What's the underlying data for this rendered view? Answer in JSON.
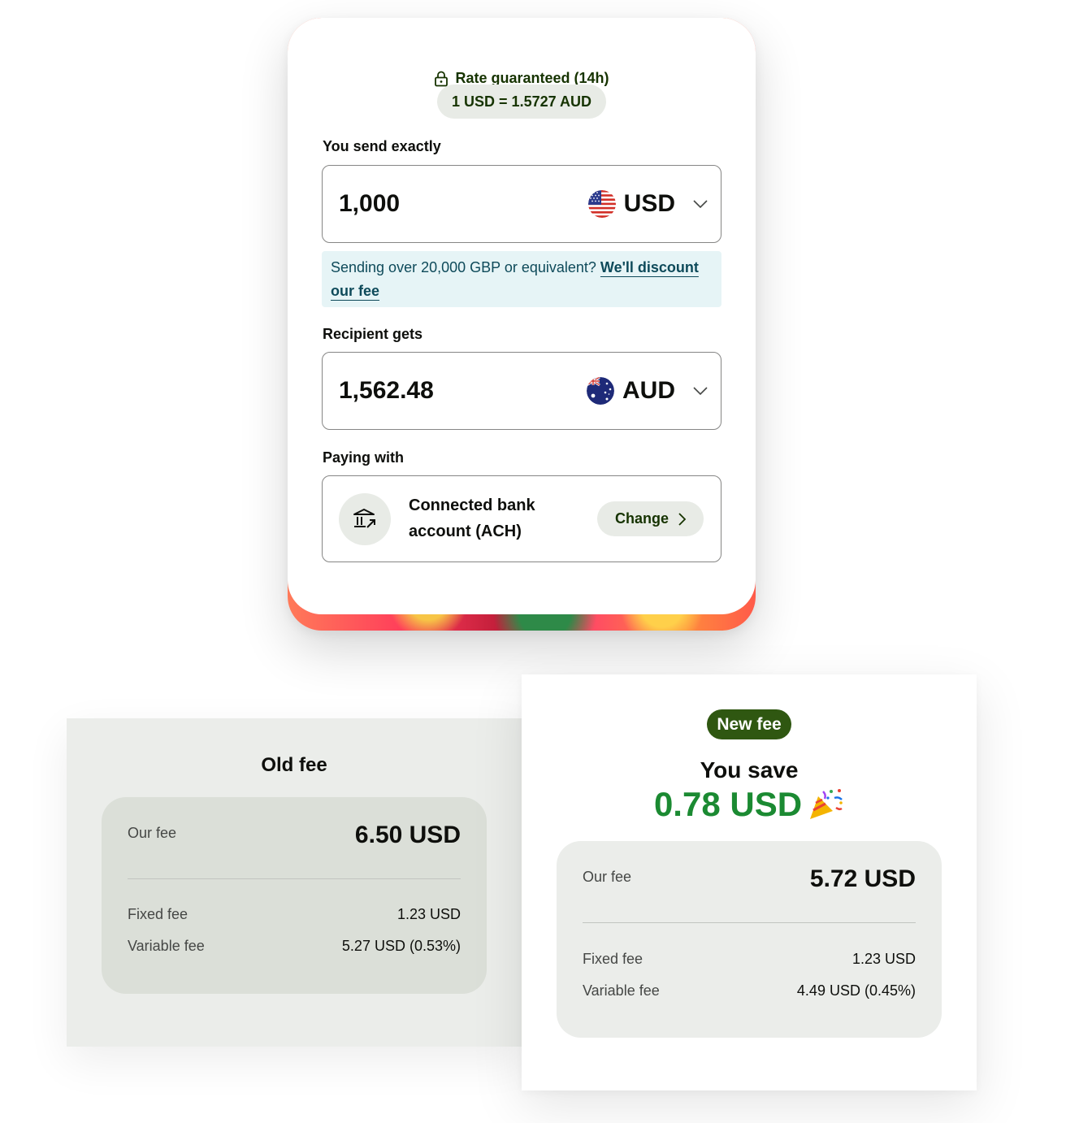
{
  "transfer": {
    "rate_guarantee": "Rate guaranteed (14h)",
    "rate": "1 USD = 1.5727 AUD",
    "send_label": "You send exactly",
    "send_amount": "1,000",
    "send_currency": "USD",
    "discount_text": "Sending over 20,000 GBP or equivalent?",
    "discount_link": "We'll discount our fee",
    "receive_label": "Recipient gets",
    "receive_amount": "1,562.48",
    "receive_currency": "AUD",
    "paying_label": "Paying with",
    "payment_method": "Connected bank account (ACH)",
    "change_label": "Change"
  },
  "old_fee": {
    "title": "Old fee",
    "our_fee_label": "Our fee",
    "our_fee": "6.50 USD",
    "fixed_label": "Fixed fee",
    "fixed": "1.23 USD",
    "variable_label": "Variable fee",
    "variable": "5.27 USD (0.53%)"
  },
  "new_fee": {
    "badge": "New fee",
    "save_label": "You save",
    "save_amount": "0.78 USD",
    "our_fee_label": "Our fee",
    "our_fee": "5.72 USD",
    "fixed_label": "Fixed fee",
    "fixed": "1.23 USD",
    "variable_label": "Variable fee",
    "variable": "4.49 USD (0.45%)"
  },
  "icons": [
    "lock-icon",
    "us-flag-icon",
    "au-flag-icon",
    "chevron-down-icon",
    "bank-icon",
    "chevron-right-icon",
    "party-popper-icon"
  ],
  "colors": {
    "brand_green": "#163300",
    "badge_green": "#2f5711",
    "saving_green": "#1b8a32",
    "info_bg": "#e6f4f6",
    "neutral_bg": "#e8ebe6"
  }
}
